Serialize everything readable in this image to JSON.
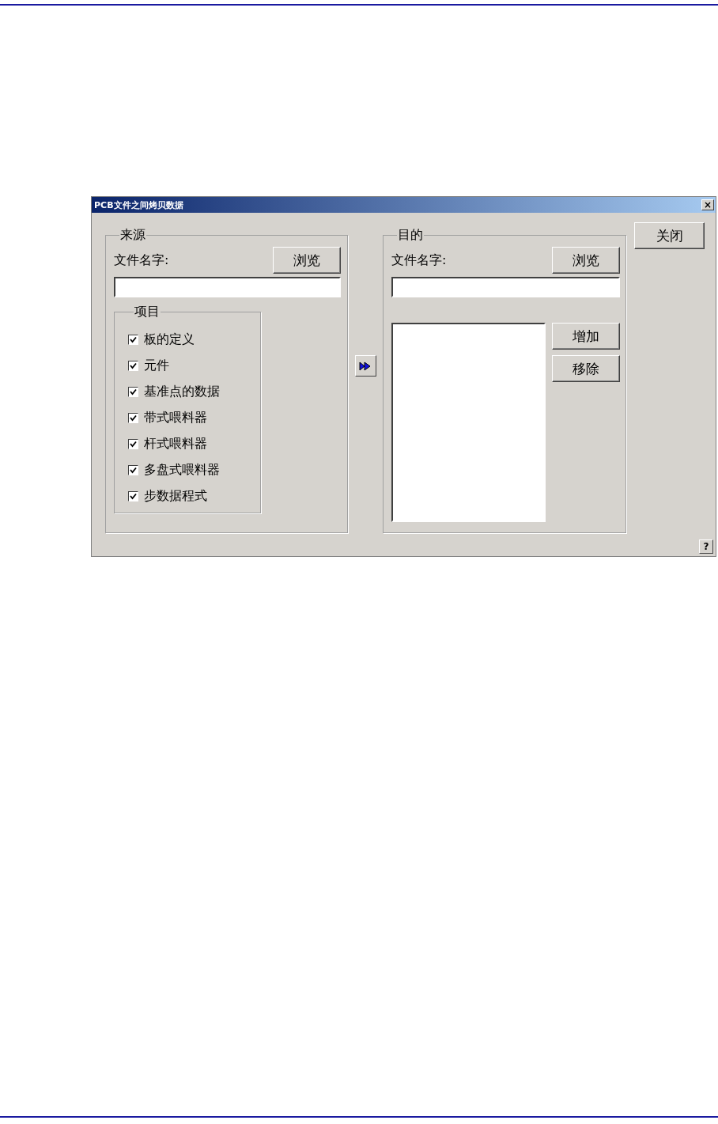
{
  "window": {
    "title": "PCB文件之间烤贝数据",
    "close_button": "×"
  },
  "source": {
    "legend": "来源",
    "file_label": "文件名字:",
    "browse_button": "浏览",
    "items_group": {
      "legend": "项目",
      "items": [
        {
          "label": "板的定义",
          "checked": true
        },
        {
          "label": "元件",
          "checked": true
        },
        {
          "label": "基准点的数据",
          "checked": true
        },
        {
          "label": "带式喂料器",
          "checked": true
        },
        {
          "label": "杆式喂料器",
          "checked": true
        },
        {
          "label": "多盘式喂料器",
          "checked": true
        },
        {
          "label": "步数据程式",
          "checked": true
        }
      ]
    }
  },
  "destination": {
    "legend": "目的",
    "file_label": "文件名字:",
    "browse_button": "浏览",
    "add_button": "增加",
    "remove_button": "移除"
  },
  "close_button": "关闭",
  "help_button": "?"
}
